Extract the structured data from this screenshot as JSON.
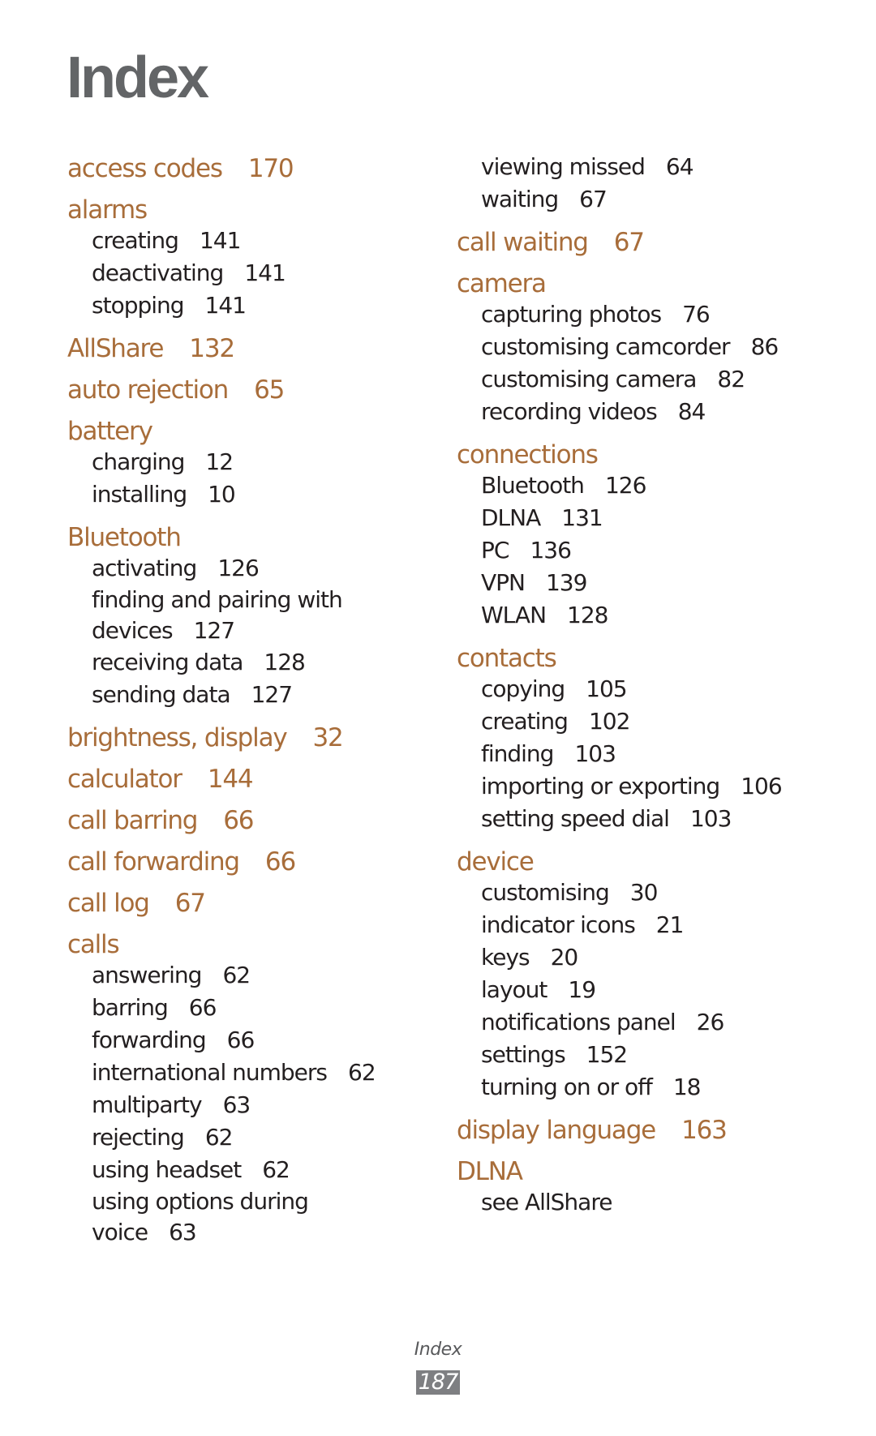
{
  "page": {
    "title": "Index",
    "footer_label": "Index",
    "page_number": "187"
  },
  "colors": {
    "heading_text": "#636567",
    "entry_accent": "#a86d3a",
    "subentry_text": "#231f20",
    "page_number_bg": "#7e7f82"
  },
  "left_column": [
    {
      "term": "access codes",
      "page": "170",
      "subs": []
    },
    {
      "term": "alarms",
      "page": "",
      "subs": [
        {
          "term": "creating",
          "page": "141"
        },
        {
          "term": "deactivating",
          "page": "141"
        },
        {
          "term": "stopping",
          "page": "141"
        }
      ]
    },
    {
      "term": "AllShare",
      "page": "132",
      "subs": []
    },
    {
      "term": "auto rejection",
      "page": "65",
      "subs": []
    },
    {
      "term": "battery",
      "page": "",
      "subs": [
        {
          "term": "charging",
          "page": "12"
        },
        {
          "term": "installing",
          "page": "10"
        }
      ]
    },
    {
      "term": "Bluetooth",
      "page": "",
      "subs": [
        {
          "term": "activating",
          "page": "126"
        },
        {
          "term": "finding and pairing with devices",
          "page": "127"
        },
        {
          "term": "receiving data",
          "page": "128"
        },
        {
          "term": "sending data",
          "page": "127"
        }
      ]
    },
    {
      "term": "brightness, display",
      "page": "32",
      "subs": []
    },
    {
      "term": "calculator",
      "page": "144",
      "subs": []
    },
    {
      "term": "call barring",
      "page": "66",
      "subs": []
    },
    {
      "term": "call forwarding",
      "page": "66",
      "subs": []
    },
    {
      "term": "call log",
      "page": "67",
      "subs": []
    },
    {
      "term": "calls",
      "page": "",
      "subs": [
        {
          "term": "answering",
          "page": "62"
        },
        {
          "term": "barring",
          "page": "66"
        },
        {
          "term": "forwarding",
          "page": "66"
        },
        {
          "term": "international numbers",
          "page": "62"
        },
        {
          "term": "multiparty",
          "page": "63"
        },
        {
          "term": "rejecting",
          "page": "62"
        },
        {
          "term": "using headset",
          "page": "62"
        },
        {
          "term": "using options during voice",
          "page": "63"
        }
      ]
    }
  ],
  "right_column": [
    {
      "term": "",
      "page": "",
      "continued": true,
      "subs": [
        {
          "term": "viewing missed",
          "page": "64"
        },
        {
          "term": "waiting",
          "page": "67"
        }
      ]
    },
    {
      "term": "call waiting",
      "page": "67",
      "subs": []
    },
    {
      "term": "camera",
      "page": "",
      "subs": [
        {
          "term": "capturing photos",
          "page": "76"
        },
        {
          "term": "customising camcorder",
          "page": "86"
        },
        {
          "term": "customising camera",
          "page": "82"
        },
        {
          "term": "recording videos",
          "page": "84"
        }
      ]
    },
    {
      "term": "connections",
      "page": "",
      "subs": [
        {
          "term": "Bluetooth",
          "page": "126"
        },
        {
          "term": "DLNA",
          "page": "131"
        },
        {
          "term": "PC",
          "page": "136"
        },
        {
          "term": "VPN",
          "page": "139"
        },
        {
          "term": "WLAN",
          "page": "128"
        }
      ]
    },
    {
      "term": "contacts",
      "page": "",
      "subs": [
        {
          "term": "copying",
          "page": "105"
        },
        {
          "term": "creating",
          "page": "102"
        },
        {
          "term": "finding",
          "page": "103"
        },
        {
          "term": "importing or exporting",
          "page": "106"
        },
        {
          "term": "setting speed dial",
          "page": "103"
        }
      ]
    },
    {
      "term": "device",
      "page": "",
      "subs": [
        {
          "term": "customising",
          "page": "30"
        },
        {
          "term": "indicator icons",
          "page": "21"
        },
        {
          "term": "keys",
          "page": "20"
        },
        {
          "term": "layout",
          "page": "19"
        },
        {
          "term": "notifications panel",
          "page": "26"
        },
        {
          "term": "settings",
          "page": "152"
        },
        {
          "term": "turning on or off",
          "page": "18"
        }
      ]
    },
    {
      "term": "display language",
      "page": "163",
      "subs": []
    },
    {
      "term": "DLNA",
      "page": "",
      "subs": [
        {
          "term": "see AllShare",
          "page": ""
        }
      ]
    }
  ]
}
